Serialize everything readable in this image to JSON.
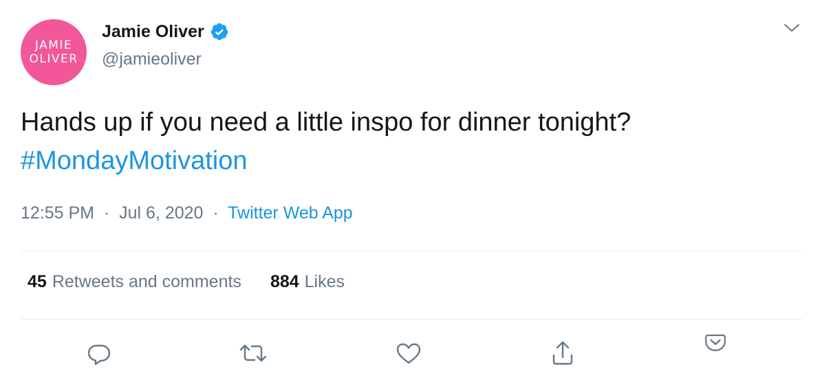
{
  "author": {
    "avatar_text_line1": "JAMIE",
    "avatar_text_line2": "OLIVER",
    "display_name": "Jamie Oliver",
    "handle": "@jamieoliver",
    "verified": true
  },
  "tweet": {
    "text": "Hands up if you need a little inspo for dinner tonight?",
    "hashtag": "#MondayMotivation",
    "time": "12:55 PM",
    "separator": "·",
    "date": "Jul 6, 2020",
    "source": "Twitter Web App"
  },
  "stats": {
    "retweets_count": "45",
    "retweets_label": "Retweets and comments",
    "likes_count": "884",
    "likes_label": "Likes"
  },
  "icons": {
    "caret": "chevron-down-icon",
    "reply": "reply-icon",
    "retweet": "retweet-icon",
    "like": "heart-icon",
    "share": "share-icon",
    "pocket": "pocket-icon"
  },
  "colors": {
    "brand_blue": "#1b95e0",
    "avatar_pink": "#f2579a",
    "text_primary": "#14171a",
    "text_secondary": "#657786",
    "divider": "#e6ecf0",
    "pocket_pink": "#ef4056"
  }
}
